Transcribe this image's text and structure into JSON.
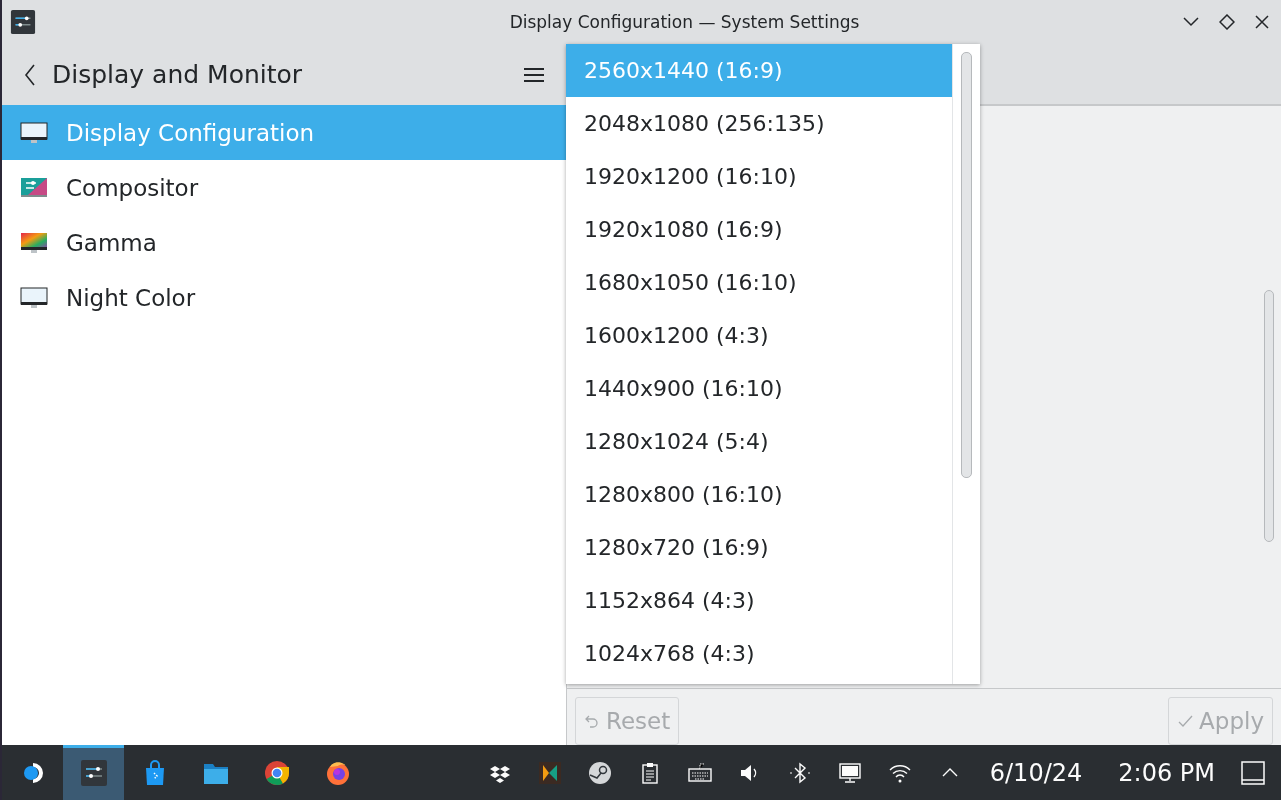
{
  "window": {
    "title": "Display Configuration — System Settings"
  },
  "sidebar": {
    "header": "Display and Monitor",
    "items": [
      {
        "label": "Display Configuration",
        "selected": true,
        "kind": "display"
      },
      {
        "label": "Compositor",
        "selected": false,
        "kind": "compositor"
      },
      {
        "label": "Gamma",
        "selected": false,
        "kind": "gamma"
      },
      {
        "label": "Night Color",
        "selected": false,
        "kind": "display"
      }
    ]
  },
  "resolution_popup": {
    "options": [
      {
        "label": "2560x1440 (16:9)",
        "selected": true
      },
      {
        "label": "2048x1080 (256:135)",
        "selected": false
      },
      {
        "label": "1920x1200 (16:10)",
        "selected": false
      },
      {
        "label": "1920x1080 (16:9)",
        "selected": false
      },
      {
        "label": "1680x1050 (16:10)",
        "selected": false
      },
      {
        "label": "1600x1200 (4:3)",
        "selected": false
      },
      {
        "label": "1440x900 (16:10)",
        "selected": false
      },
      {
        "label": "1280x1024 (5:4)",
        "selected": false
      },
      {
        "label": "1280x800 (16:10)",
        "selected": false
      },
      {
        "label": "1280x720 (16:9)",
        "selected": false
      },
      {
        "label": "1152x864 (4:3)",
        "selected": false
      },
      {
        "label": "1024x768 (4:3)",
        "selected": false
      }
    ]
  },
  "footer": {
    "buttons": [
      {
        "label": "Reset",
        "kind": "reset",
        "disabled": true
      },
      {
        "label": "Apply",
        "kind": "apply",
        "disabled": true
      }
    ]
  },
  "taskbar": {
    "tasks": [
      {
        "kind": "launcher",
        "active": false
      },
      {
        "kind": "settings",
        "active": true
      },
      {
        "kind": "store",
        "active": false
      },
      {
        "kind": "files",
        "active": false
      },
      {
        "kind": "chrome",
        "active": false
      },
      {
        "kind": "firefox",
        "active": false
      }
    ],
    "tray": [
      {
        "kind": "dropbox"
      },
      {
        "kind": "tile"
      },
      {
        "kind": "steam"
      },
      {
        "kind": "clipboard"
      },
      {
        "kind": "keyboard"
      },
      {
        "kind": "volume"
      },
      {
        "kind": "bluetooth"
      },
      {
        "kind": "display"
      },
      {
        "kind": "wifi"
      },
      {
        "kind": "expand"
      }
    ],
    "date": "6/10/24",
    "time": "2:06 PM"
  }
}
